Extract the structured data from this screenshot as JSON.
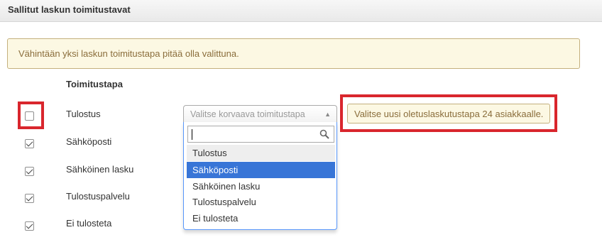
{
  "header": {
    "title": "Sallitut laskun toimitustavat"
  },
  "alert": {
    "text": "Vähintään yksi laskun toimitustapa pitää olla valittuna."
  },
  "table": {
    "column_header": "Toimitustapa",
    "rows": [
      {
        "label": "Tulostus",
        "checked": false
      },
      {
        "label": "Sähköposti",
        "checked": true
      },
      {
        "label": "Sähköinen lasku",
        "checked": true
      },
      {
        "label": "Tulostuspalvelu",
        "checked": true
      },
      {
        "label": "Ei tulosteta",
        "checked": true
      }
    ]
  },
  "replacement_select": {
    "placeholder": "Valitse korvaava toimitustapa",
    "search_value": "",
    "options": [
      "Tulostus",
      "Sähköposti",
      "Sähköinen lasku",
      "Tulostuspalvelu",
      "Ei tulosteta"
    ],
    "highlighted": "Sähköposti"
  },
  "tooltip": {
    "text": "Valitse uusi oletuslaskutustapa 24 asiakkaalle."
  },
  "colors": {
    "highlight_red": "#d9262d",
    "warning_bg": "#fcf8e3",
    "warning_text": "#8a6d3b",
    "selected_option_bg": "#3875d7"
  }
}
